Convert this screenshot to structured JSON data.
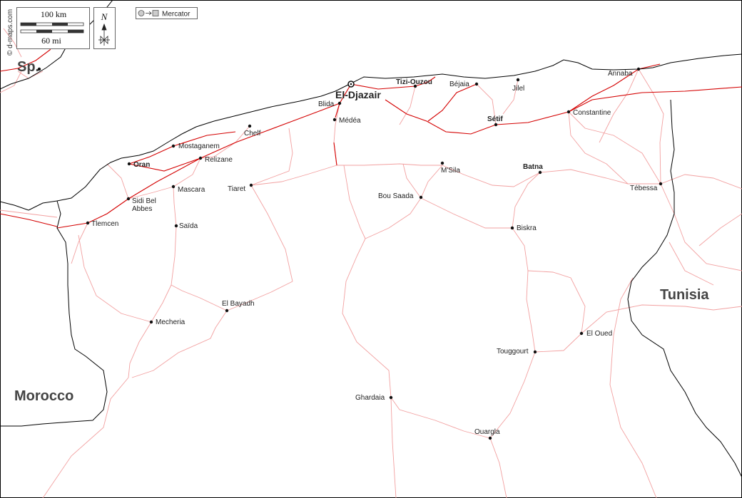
{
  "credit": "© d-maps.com",
  "scale": {
    "km_label": "100 km",
    "mi_label": "60 mi"
  },
  "north_label": "N",
  "projection": "Mercator",
  "colors": {
    "border": "#000000",
    "major_road": "#d40000",
    "minor_road": "#f2a0a0",
    "city_dot": "#111111"
  },
  "countries": {
    "spain": "Sp.",
    "morocco": "Morocco",
    "tunisia": "Tunisia"
  },
  "capital": "El-Djazair",
  "cities": {
    "tizi": "Tizi-Ouzou",
    "bejaia": "Béjaia",
    "jijel": "Jilel",
    "annaba": "Annaba",
    "blida": "Blida",
    "medea": "Médéa",
    "setif": "Sétif",
    "constantine": "Constantine",
    "chelf": "Chelf",
    "mostaganem": "Mostaganem",
    "oran": "Oran",
    "relizane": "Relizane",
    "msila": "M'Sila",
    "batna": "Batna",
    "tiaret": "Tiaret",
    "mascara": "Mascara",
    "bousaada": "Bou Saada",
    "tebessa": "Tébessa",
    "sba_line1": "Sidi Bel",
    "sba_line2": "Abbes",
    "tlemcen": "Tlemcen",
    "saida": "Saïda",
    "biskra": "Biskra",
    "elbayadh": "El Bayadh",
    "mecheria": "Mecheria",
    "eloued": "El Oued",
    "touggourt": "Touggourt",
    "ghardaia": "Ghardaia",
    "ouargla": "Ouargla"
  }
}
